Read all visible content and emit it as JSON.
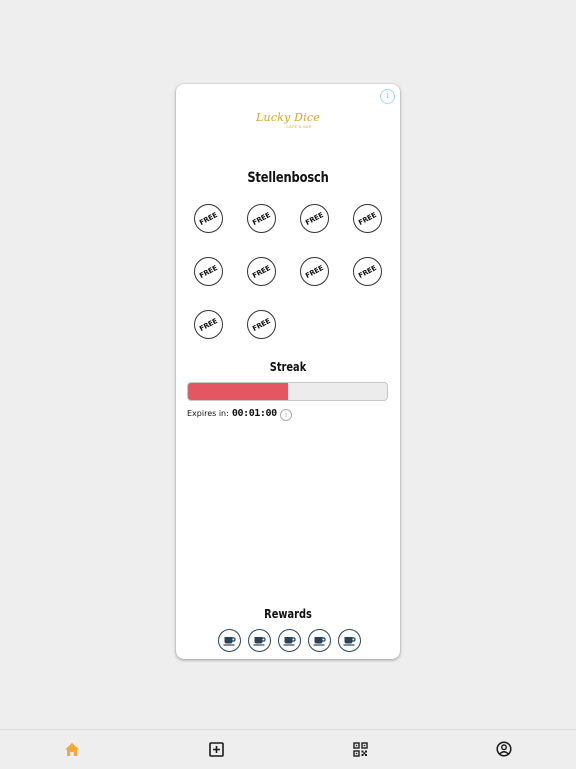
{
  "card": {
    "logo_text": "Lucky Dice",
    "logo_subtext": "CAFE & BAR",
    "info_icon_glyph": "i",
    "location": "Stellenbosch"
  },
  "stamps": [
    {
      "label": "FREE"
    },
    {
      "label": "FREE"
    },
    {
      "label": "FREE"
    },
    {
      "label": "FREE"
    },
    {
      "label": "FREE"
    },
    {
      "label": "FREE"
    },
    {
      "label": "FREE"
    },
    {
      "label": "FREE"
    },
    {
      "label": "FREE"
    },
    {
      "label": "FREE"
    }
  ],
  "streak": {
    "title": "Streak",
    "progress_fraction": 0.5,
    "progress_color": "#e35662",
    "expires_label": "Expires in:",
    "expires_time": "00:01:00"
  },
  "rewards": {
    "title": "Rewards",
    "items": [
      {
        "icon": "coffee-cup-icon"
      },
      {
        "icon": "coffee-cup-icon"
      },
      {
        "icon": "coffee-cup-icon"
      },
      {
        "icon": "coffee-cup-icon"
      },
      {
        "icon": "coffee-cup-icon"
      }
    ]
  },
  "nav": {
    "active_color": "#f3a83b",
    "items": [
      {
        "icon": "home-icon",
        "active": true
      },
      {
        "icon": "add-square-icon",
        "active": false
      },
      {
        "icon": "qr-code-icon",
        "active": false
      },
      {
        "icon": "user-circle-icon",
        "active": false
      }
    ]
  }
}
